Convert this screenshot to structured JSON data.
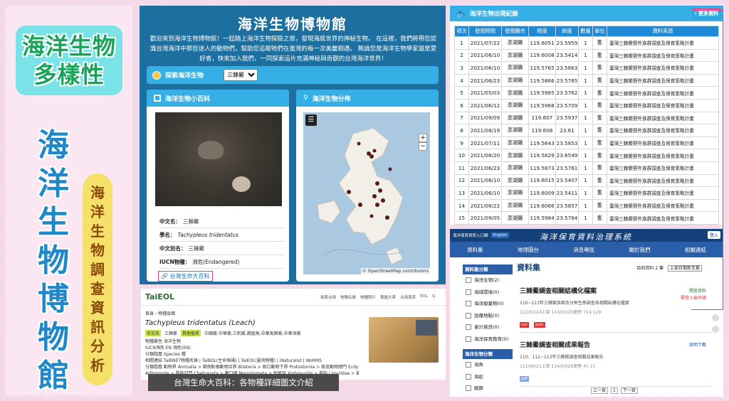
{
  "poster": {
    "title_line1": "海洋生物",
    "title_line2": "多樣性",
    "vertical_title": [
      "海",
      "洋",
      "生",
      "物",
      "博",
      "物",
      "館"
    ],
    "vertical_subtitle": [
      "海",
      "洋",
      "生",
      "物",
      "調",
      "查",
      "資",
      "訊",
      "分",
      "析"
    ]
  },
  "museum": {
    "title": "海洋生物博物館",
    "intro": "歡迎來到海洋生物博物館！一起踏上海洋生物探險之旅，發現海底世界的神秘生物。 在這裡，我們將帶您認識台灣海洋中那些迷人的動物們，幫助您追蹤牠們在臺灣的每一次美麗相遇。 無論您是海洋生物學家還是愛好者，快來加入我們，一同探索這片充滿神秘與奇觀的台灣海洋世界！",
    "explore_label": "探索海洋生物",
    "species_select": "三棘鱟",
    "wiki_panel_title": "海洋生物小百科",
    "map_panel_title": "海洋生物分佈",
    "info": {
      "chinese_name_label": "中文名：",
      "chinese_name": "三棘鱟",
      "sci_name_label": "學名：",
      "sci_name": "Tachypleus tridentatus",
      "alias_label": "中文別名：",
      "alias": "三棘鱟",
      "iucn_label": "IUCN物種：",
      "iucn": "瀕危(Endangered)"
    },
    "wiki_link": "台灣生命大百科",
    "map_menu": "☰",
    "zoom_in": "+",
    "zoom_out": "−",
    "attribution": "© OpenStreetMap contributors"
  },
  "records": {
    "title": "海洋生物出現紀錄",
    "more": "更多資料",
    "headers": [
      "項次",
      "發現時間",
      "發現縣市",
      "經度",
      "緯度",
      "數量",
      "單位",
      "資料來源"
    ],
    "rows": [
      [
        "1",
        "2021/07/22",
        "澎湖縣",
        "119.6051",
        "23.5959",
        "1",
        "隻",
        "臺灣三棘鱟野外族群調查及保育策略計畫"
      ],
      [
        "2",
        "2021/06/10",
        "澎湖縣",
        "119.6008",
        "23.5414",
        "1",
        "隻",
        "臺灣三棘鱟野外族群調查及保育策略計畫"
      ],
      [
        "3",
        "2021/06/10",
        "澎湖縣",
        "119.5765",
        "23.5863",
        "1",
        "隻",
        "臺灣三棘鱟野外族群調查及保育策略計畫"
      ],
      [
        "4",
        "2021/06/23",
        "澎湖縣",
        "119.5866",
        "23.5765",
        "1",
        "隻",
        "臺灣三棘鱟野外族群調查及保育策略計畫"
      ],
      [
        "5",
        "2021/05/03",
        "澎湖縣",
        "119.5985",
        "23.5762",
        "1",
        "隻",
        "臺灣三棘鱟野外族群調查及保育策略計畫"
      ],
      [
        "6",
        "2021/06/12",
        "澎湖縣",
        "119.5968",
        "23.5709",
        "1",
        "隻",
        "臺灣三棘鱟野外族群調查及保育策略計畫"
      ],
      [
        "7",
        "2021/09/09",
        "澎湖縣",
        "119.607",
        "23.5937",
        "1",
        "隻",
        "臺灣三棘鱟野外族群調查及保育策略計畫"
      ],
      [
        "8",
        "2021/08/19",
        "澎湖縣",
        "119.608",
        "23.61",
        "1",
        "隻",
        "臺灣三棘鱟野外族群調查及保育策略計畫"
      ],
      [
        "9",
        "2021/07/11",
        "澎湖縣",
        "119.5643",
        "23.5853",
        "1",
        "隻",
        "臺灣三棘鱟野外族群調查及保育策略計畫"
      ],
      [
        "10",
        "2021/08/20",
        "澎湖縣",
        "119.5829",
        "23.6549",
        "1",
        "隻",
        "臺灣三棘鱟野外族群調查及保育策略計畫"
      ],
      [
        "11",
        "2021/06/23",
        "澎湖縣",
        "119.5873",
        "23.5761",
        "1",
        "隻",
        "臺灣三棘鱟野外族群調查及保育策略計畫"
      ],
      [
        "12",
        "2021/06/10",
        "澎湖縣",
        "119.6015",
        "23.5407",
        "1",
        "隻",
        "臺灣三棘鱟野外族群調查及保育策略計畫"
      ],
      [
        "13",
        "2021/06/10",
        "澎湖縣",
        "119.6009",
        "23.5411",
        "1",
        "隻",
        "臺灣三棘鱟野外族群調查及保育策略計畫"
      ],
      [
        "14",
        "2021/08/22",
        "澎湖縣",
        "119.6066",
        "23.5857",
        "1",
        "隻",
        "臺灣三棘鱟野外族群調查及保育策略計畫"
      ],
      [
        "15",
        "2021/09/05",
        "澎湖縣",
        "119.5984",
        "23.5764",
        "1",
        "隻",
        "臺灣三棘鱟野外族群調查及保育策略計畫"
      ]
    ]
  },
  "eol": {
    "logo": "TaiEOL",
    "nav": [
      "探索台灣",
      "物種名錄",
      "物種照片",
      "專題文章",
      "台灣保育",
      "EOL",
      "Q"
    ],
    "breadcrumb": "首頁 › 物種頁面",
    "sci_name": "Tachypleus tridentatus (Leach)",
    "tags": [
      "中文名",
      "三棘鱟",
      "其他俗名",
      "中國鱟,中華鱟,三刺鱟,鋼盔魚,中華馬蹄鱟,中華海鱟"
    ],
    "lines": [
      "物種屬性  海洋生物",
      "IUCN瀕危  EN 瀕危(EN)",
      "分類階層  Species 種",
      "相關連結  TaiBNET物種名錄 | TaiBOL(生命條碼) | TaiEOL(臺灣物種) | iNaturalist | WoRMS",
      "分類階層  動物界 Animalia > 兩側對稱動物亞界 Bilateria > 原口動物下界 Protostomia > 蛻皮動物總門 Ecdysozoa > 泛節肢動物",
      "Arthropoda > 螯肢亞門 Chelicerata > 腹口綱 Merostomata > 劍尾目 Xiphosurida > 鱟科 Limulidae > 鱟屬 Tachypleus"
    ],
    "caption": "台灣生命大百科：各物種詳細圖文介紹"
  },
  "ocean": {
    "topbar": [
      "海洋保育資訊入口網",
      "English"
    ],
    "brand": "海洋保育資料治理系統",
    "login": "登入",
    "nav": [
      "資料集",
      "地理圖台",
      "消息專區",
      "關於我們",
      "相關連結"
    ],
    "side_heading1": "資料集分類",
    "side_items1": [
      "海洋生物(2)",
      "海域環境(0)",
      "海洋廢棄物(0)",
      "設備地點(0)",
      "會計資訊(0)",
      "海洋保育教育(0)"
    ],
    "side_heading2": "海洋生物分類",
    "side_items2": [
      "海魚",
      "海蛇",
      "鯨豚"
    ],
    "main_title": "資料集",
    "sort_label": "目前資料 2 筆",
    "sort_select": "上架日期新至舊",
    "cards": [
      {
        "title": "三棘鱟調查相關結構化檔案",
        "desc": "110~113年三棘鱟族群及分佈生態調查各相關結構化檔案",
        "meta": "112/01/24上架   114/03/20更新   714   129",
        "badge1": "開放資料",
        "badge2": "需登入後申請",
        "formats": [
          "csv",
          "json"
        ]
      },
      {
        "title": "三棘鱟調查相關成果報告",
        "desc": "110、112~113年三棘鱟調查相關成果報告",
        "meta": "111/04/21上架   114/03/20更新   41   21",
        "badge1": "說明下載",
        "formats": [
          "pdf"
        ]
      }
    ],
    "pager": [
      "上一頁",
      "1",
      "下一頁"
    ]
  },
  "colors": {
    "accent": "#36aee6",
    "museum_bg": "#1c6f9e",
    "poster_pink": "#f4d9e9",
    "highlight": "#e53f8c"
  }
}
